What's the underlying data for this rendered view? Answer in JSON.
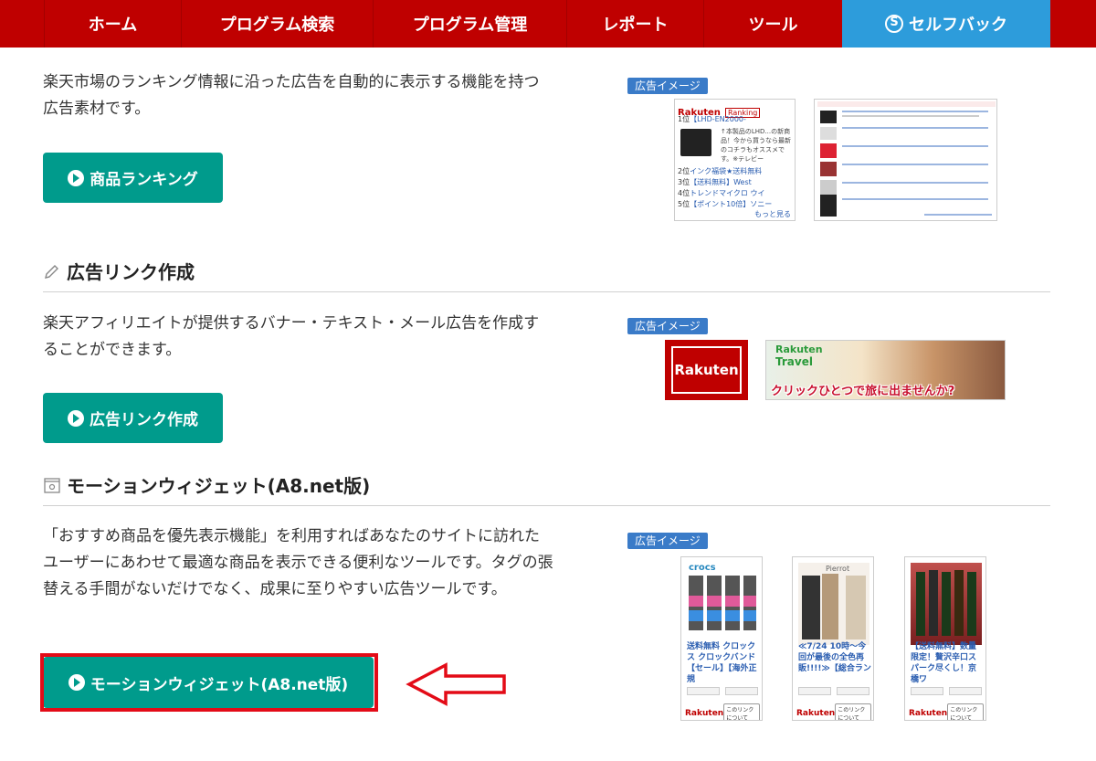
{
  "nav": {
    "items": [
      "ホーム",
      "プログラム検索",
      "プログラム管理",
      "レポート",
      "ツール"
    ],
    "self": "セルフバック"
  },
  "ranking": {
    "desc": "楽天市場のランキング情報に沿った広告を自動的に表示する機能を持つ広告素材です。",
    "button": "商品ランキング",
    "badge": "広告イメージ",
    "sample": {
      "logo": "Rakuten",
      "tag": "Ranking",
      "rank1": "1位",
      "item1": "【LHD-EN2000-",
      "blurb": "↑本製品のLHD...の新商品！今から買うなら最新のコチラもオススメです。※テレビー",
      "rank2": "2位",
      "item2": "インク福袋★送料無料",
      "rank3": "3位",
      "item3": "【送料無料】West",
      "rank4": "4位",
      "item4": "トレンドマイクロ ウイ",
      "rank5": "5位",
      "item5": "【ポイント10倍】ソニー",
      "more": "もっと見る"
    }
  },
  "linkgen": {
    "heading": "広告リンク作成",
    "desc": "楽天アフィリエイトが提供するバナー・テキスト・メール広告を作成することができます。",
    "button": "広告リンク作成",
    "badge": "広告イメージ",
    "banner_logo": "Rakuten",
    "travel_logo1": "Rakuten",
    "travel_logo2": "Travel",
    "travel_text": "クリックひとつで旅に出ませんか?"
  },
  "motion": {
    "heading": "モーションウィジェット(A8.net版)",
    "desc": "「おすすめ商品を優先表示機能」を利用すればあなたのサイトに訪れたユーザーにあわせて最適な商品を表示できる便利なツールです。タグの張替える手間がないだけでなく、成果に至りやすい広告ツールです。",
    "button": "モーションウィジェット(A8.net版)",
    "badge": "広告イメージ",
    "widgets": [
      {
        "brand": "crocs",
        "caption": "送料無料 クロックス クロックバンド【セール】【海外正規",
        "logo": "Rakuten",
        "link": "このリンクについて"
      },
      {
        "brand": "Pierrot",
        "caption": "≪7/24 10時～今回が最後の全色再販!!!!≫【総合ラン",
        "logo": "Rakuten",
        "link": "このリンクについて"
      },
      {
        "brand": "",
        "caption": "【送料無料】数量限定！贅沢辛口スパーク尽くし！京橋ワ",
        "logo": "Rakuten",
        "link": "このリンクについて"
      }
    ]
  }
}
